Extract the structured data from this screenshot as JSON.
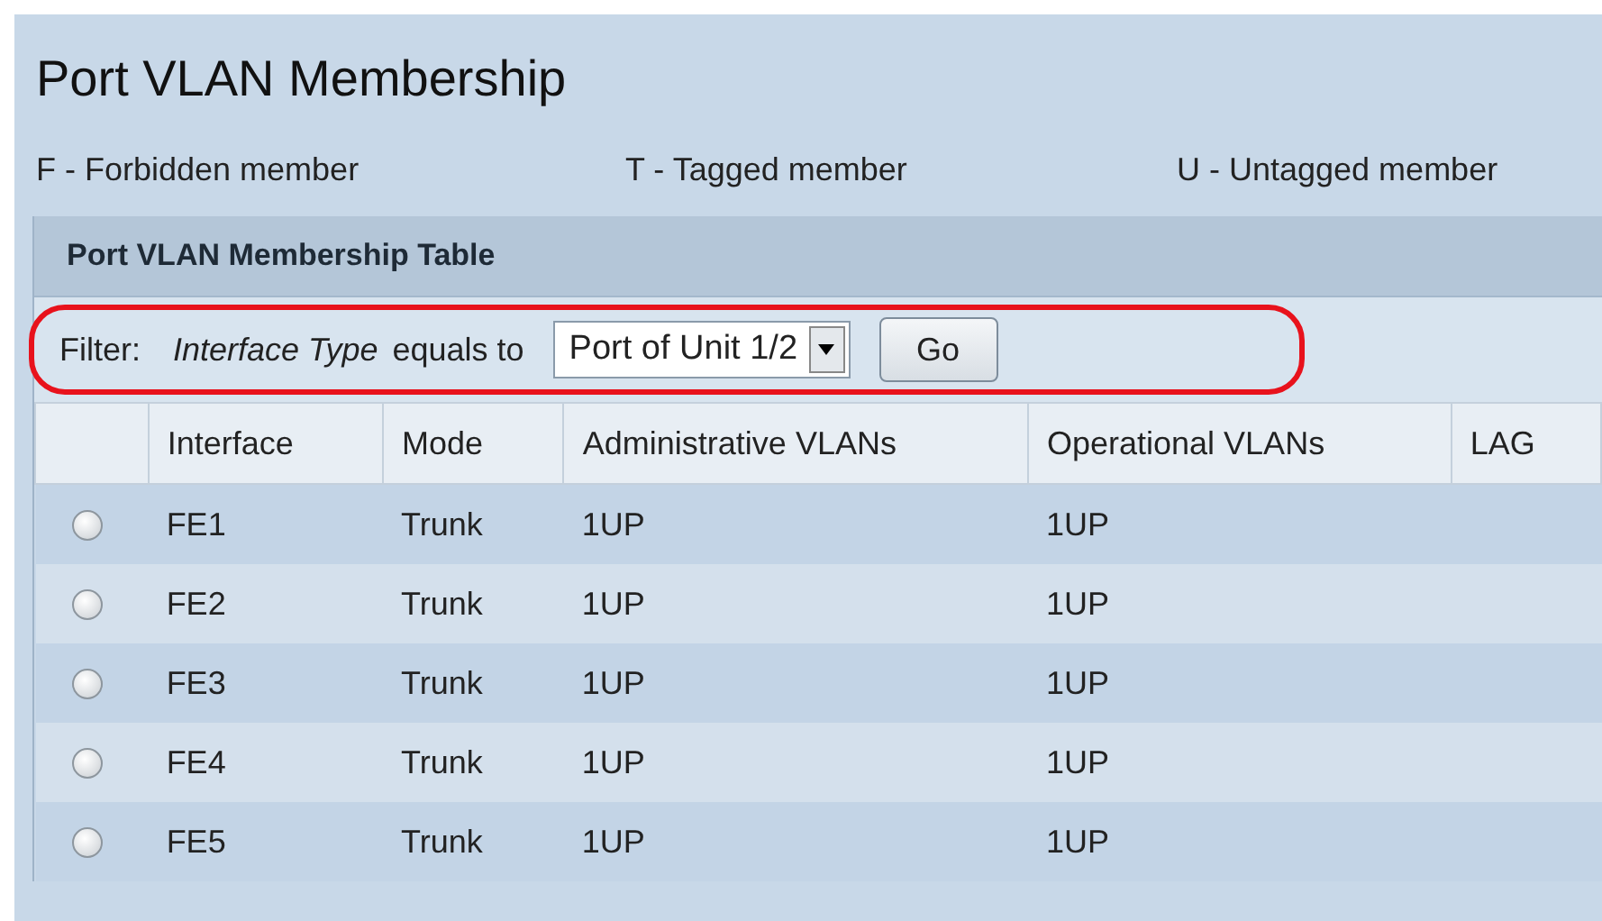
{
  "title": "Port VLAN Membership",
  "legend": [
    "F - Forbidden member",
    "T - Tagged member",
    "U - Untagged member"
  ],
  "table": {
    "title": "Port VLAN Membership Table",
    "filter": {
      "label": "Filter:",
      "field": "Interface Type",
      "operator": "equals to",
      "value": "Port of Unit 1/2",
      "button": "Go"
    },
    "columns": [
      "Interface",
      "Mode",
      "Administrative VLANs",
      "Operational VLANs",
      "LAG"
    ],
    "rows": [
      {
        "selected": false,
        "cells": [
          "FE1",
          "Trunk",
          "1UP",
          "1UP",
          ""
        ]
      },
      {
        "selected": false,
        "cells": [
          "FE2",
          "Trunk",
          "1UP",
          "1UP",
          ""
        ]
      },
      {
        "selected": false,
        "cells": [
          "FE3",
          "Trunk",
          "1UP",
          "1UP",
          ""
        ]
      },
      {
        "selected": false,
        "cells": [
          "FE4",
          "Trunk",
          "1UP",
          "1UP",
          ""
        ]
      },
      {
        "selected": false,
        "cells": [
          "FE5",
          "Trunk",
          "1UP",
          "1UP",
          ""
        ]
      }
    ]
  }
}
